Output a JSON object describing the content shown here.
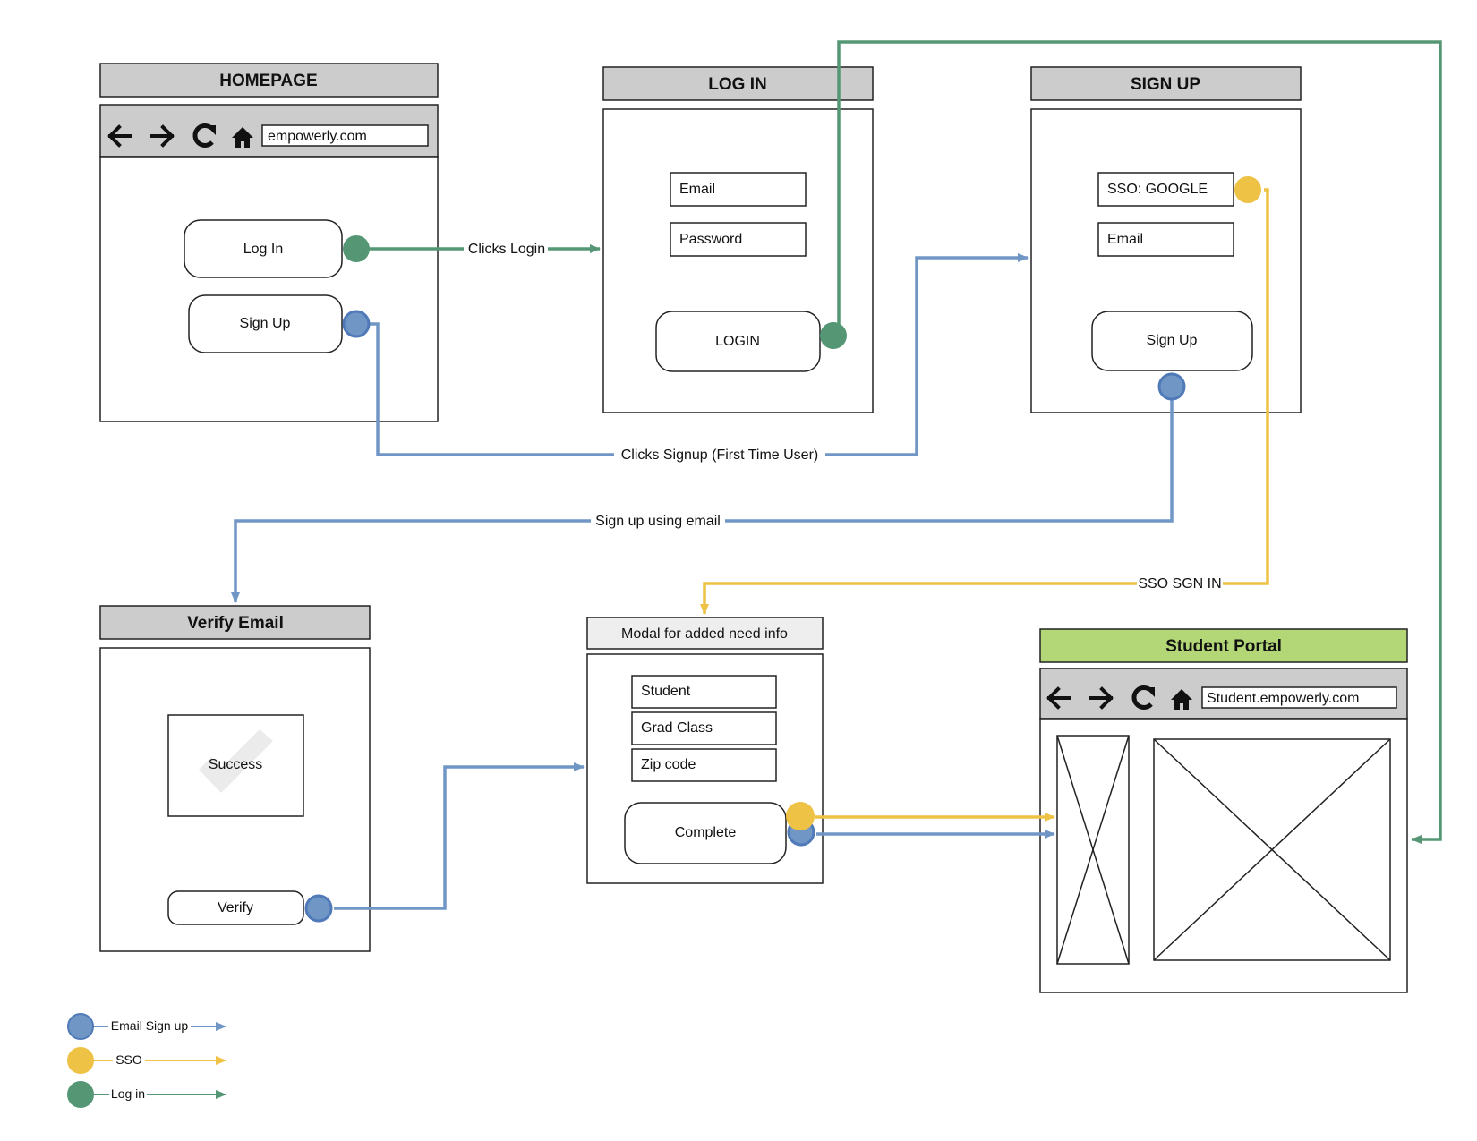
{
  "colors": {
    "email_signup": "#7096c6",
    "sso": "#eec244",
    "log_in": "#559775",
    "header_gray": "#cccccc",
    "header_green": "#b3d776",
    "modal_header": "#eeeeee"
  },
  "icons": [
    "back-arrow-icon",
    "forward-arrow-icon",
    "reload-icon",
    "home-icon",
    "checkmark-icon",
    "image-placeholder-icon"
  ],
  "homepage": {
    "title": "HOMEPAGE",
    "url": "empowerly.com",
    "login_button": "Log In",
    "signup_button": "Sign Up"
  },
  "login": {
    "title": "LOG IN",
    "email_field": "Email",
    "password_field": "Password",
    "login_button": "LOGIN"
  },
  "signup": {
    "title": "SIGN UP",
    "sso_field": "SSO: GOOGLE",
    "email_field": "Email",
    "signup_button": "Sign Up"
  },
  "verify": {
    "title": "Verify Email",
    "success_text": "Success",
    "verify_button": "Verify"
  },
  "modal": {
    "title": "Modal for added need info",
    "student_field": "Student",
    "grad_class_field": "Grad Class",
    "zip_field": "Zip code",
    "complete_button": "Complete"
  },
  "portal": {
    "title": "Student Portal",
    "url": "Student.empowerly.com"
  },
  "edges": {
    "clicks_login": "Clicks Login",
    "clicks_signup": "Clicks Signup (First Time User)",
    "signup_email": "Sign up using email",
    "sso_sign_in": "SSO SGN IN"
  },
  "legend": {
    "email_signup": "Email Sign up",
    "sso": "SSO",
    "log_in": "Log in"
  }
}
